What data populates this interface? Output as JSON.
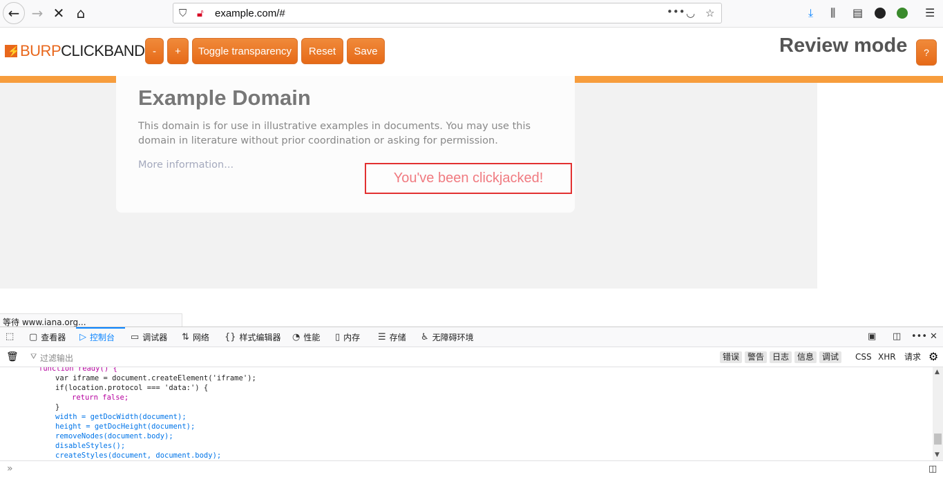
{
  "browser": {
    "url": "example.com/#"
  },
  "burp": {
    "logo_part1": "BURP",
    "logo_part2": "CLICKBANDIT",
    "buttons": {
      "minus": "-",
      "plus": "+",
      "toggle": "Toggle transparency",
      "reset": "Reset",
      "save": "Save",
      "help": "?"
    },
    "mode_label": "Review mode"
  },
  "page": {
    "title": "Example Domain",
    "description": "This domain is for use in illustrative examples in documents. You may use this domain in literature without prior coordination or asking for permission.",
    "link": "More information...",
    "clickjack_text": "You've been clickjacked!"
  },
  "status": {
    "text": "等待 www.iana.org..."
  },
  "devtools": {
    "tabs": [
      {
        "label": "查看器"
      },
      {
        "label": "控制台"
      },
      {
        "label": "调试器"
      },
      {
        "label": "网络"
      },
      {
        "label": "样式编辑器"
      },
      {
        "label": "性能"
      },
      {
        "label": "内存"
      },
      {
        "label": "存储"
      },
      {
        "label": "无障碍环境"
      }
    ],
    "filter_placeholder": "过滤输出",
    "filters": [
      "错误",
      "警告",
      "日志",
      "信息",
      "调试",
      "CSS",
      "XHR",
      "请求"
    ],
    "code_lines": [
      "function ready() {",
      "var iframe = document.createElement('iframe');",
      "if(location.protocol === 'data:') {",
      "return false;",
      "}",
      "width = getDocWidth(document);",
      "height = getDocHeight(document);",
      "removeNodes(document.body);",
      "disableStyles();",
      "createStyles(document, document.body);"
    ],
    "prompt": "»"
  },
  "colors": {
    "burp_orange": "#f79d3d",
    "button_orange": "#e97528",
    "clickjack_border": "#e23030",
    "console_active": "#0a84ff"
  }
}
